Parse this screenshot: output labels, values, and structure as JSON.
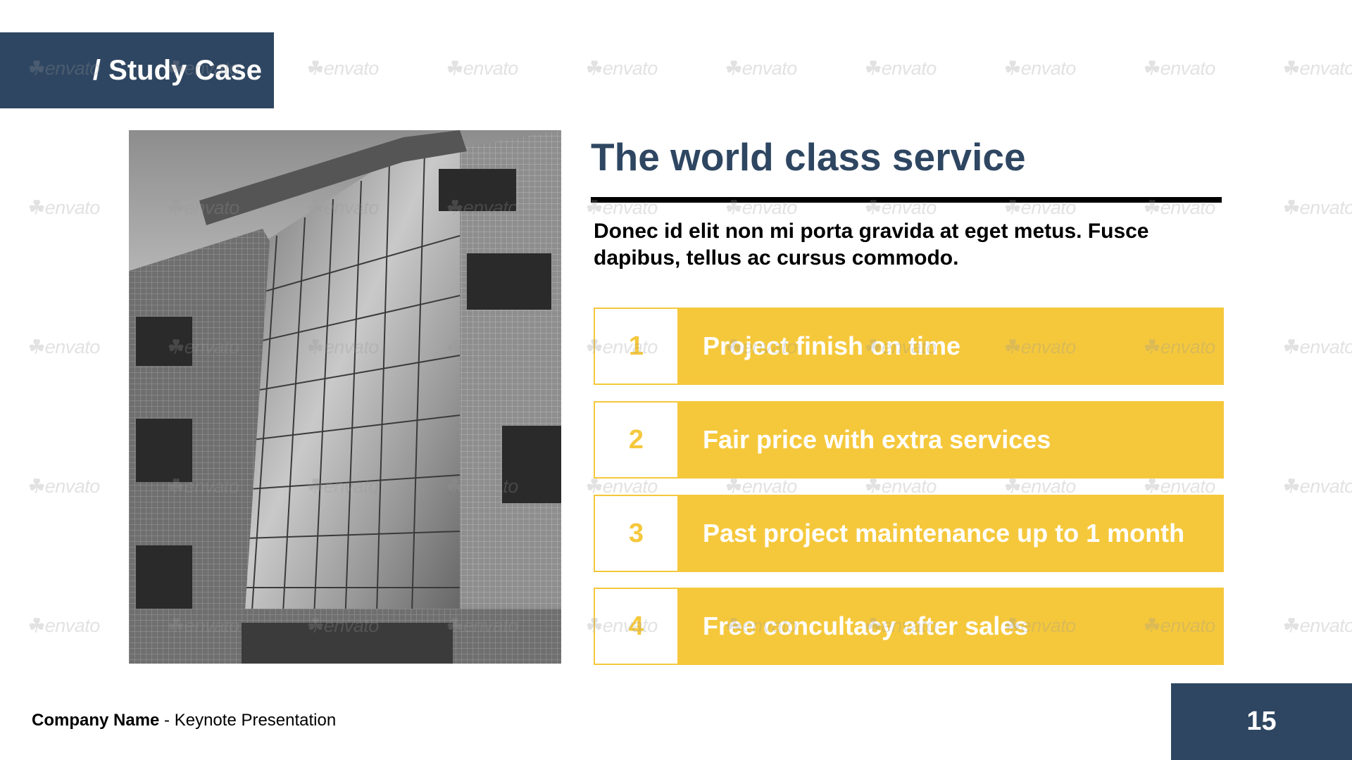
{
  "slide": {
    "section_tag": "/ Study Case",
    "headline": "The world class service",
    "intro": "Donec id elit non mi porta gravida at eget metus. Fusce dapibus, tellus ac cursus commodo.",
    "features": [
      {
        "number": "1",
        "label": "Project finish on time"
      },
      {
        "number": "2",
        "label": "Fair price with extra services"
      },
      {
        "number": "3",
        "label": "Past project maintenance up to 1 month"
      },
      {
        "number": "4",
        "label": "Free concultacy after sales"
      }
    ],
    "footer": {
      "company": "Company Name",
      "rest": " - Keynote Presentation"
    },
    "page_number": "15",
    "watermark_text": "envato"
  },
  "colors": {
    "navy": "#2e4661",
    "yellow": "#f5c83c",
    "black": "#000000",
    "white": "#ffffff"
  },
  "photo": {
    "subject": "building-facade-photo",
    "style": "grayscale"
  }
}
